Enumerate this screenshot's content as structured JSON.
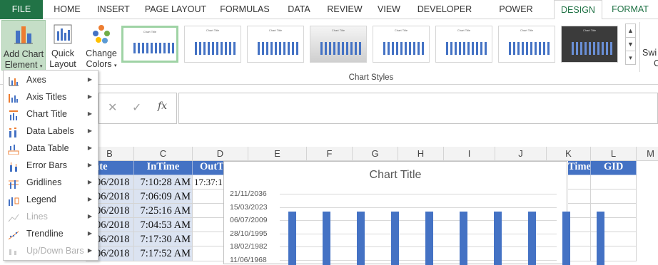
{
  "tabs": [
    "FILE",
    "HOME",
    "INSERT",
    "PAGE LAYOUT",
    "FORMULAS",
    "DATA",
    "REVIEW",
    "VIEW",
    "DEVELOPER",
    "POWER QUERY",
    "DESIGN",
    "FORMAT"
  ],
  "ribbon": {
    "add_chart_element": [
      "Add Chart",
      "Element"
    ],
    "quick_layout": [
      "Quick",
      "Layout"
    ],
    "change_colors": [
      "Change",
      "Colors"
    ],
    "chart_styles_label": "Chart Styles",
    "switch_partial": [
      "Swi",
      "C"
    ]
  },
  "formula_bar": {
    "cancel_icon": "✕",
    "enter_icon": "✓",
    "fx_label": "fx"
  },
  "columns": [
    "B",
    "C",
    "D",
    "E",
    "F",
    "G",
    "H",
    "I",
    "J",
    "K",
    "L",
    "M"
  ],
  "table": {
    "headers": {
      "b": "ate",
      "c": "InTime",
      "d": "OutT",
      "k": "Time",
      "l": "GID"
    },
    "rows": [
      {
        "b": "06/2018",
        "c": "7:10:28 AM",
        "d": "17:37:1"
      },
      {
        "b": "06/2018",
        "c": "7:06:09 AM",
        "d": ""
      },
      {
        "b": "06/2018",
        "c": "7:25:16 AM",
        "d": ""
      },
      {
        "b": "06/2018",
        "c": "7:04:53 AM",
        "d": ""
      },
      {
        "b": "06/2018",
        "c": "7:17:30 AM",
        "d": ""
      },
      {
        "b": "06/2018",
        "c": "7:17:52 AM",
        "d": ""
      }
    ]
  },
  "menu": [
    {
      "label": "Axes",
      "icon": "axes-icon",
      "enabled": true
    },
    {
      "label": "Axis Titles",
      "icon": "axis-titles-icon",
      "enabled": true
    },
    {
      "label": "Chart Title",
      "icon": "chart-title-icon",
      "enabled": true
    },
    {
      "label": "Data Labels",
      "icon": "data-labels-icon",
      "enabled": true
    },
    {
      "label": "Data Table",
      "icon": "data-table-icon",
      "enabled": true
    },
    {
      "label": "Error Bars",
      "icon": "error-bars-icon",
      "enabled": true
    },
    {
      "label": "Gridlines",
      "icon": "gridlines-icon",
      "enabled": true
    },
    {
      "label": "Legend",
      "icon": "legend-icon",
      "enabled": true
    },
    {
      "label": "Lines",
      "icon": "lines-icon",
      "enabled": false
    },
    {
      "label": "Trendline",
      "icon": "trendline-icon",
      "enabled": true
    },
    {
      "label": "Up/Down Bars",
      "icon": "up-down-bars-icon",
      "enabled": false
    }
  ],
  "chart_data": {
    "type": "bar",
    "title": "Chart Title",
    "yticks": [
      "21/11/2036",
      "15/03/2023",
      "06/07/2009",
      "28/10/1995",
      "18/02/1982",
      "11/06/1968"
    ],
    "categories": [
      "",
      "",
      "",
      "",
      "",
      "",
      "",
      "",
      "",
      ""
    ],
    "values": [
      0.85,
      0.85,
      0.85,
      0.85,
      0.85,
      0.85,
      0.85,
      0.85,
      0.85,
      0.85
    ],
    "bar_color": "#4472c4"
  },
  "colors": {
    "file_tab": "#217346",
    "table_header": "#4472c4",
    "accent": "#217346"
  }
}
